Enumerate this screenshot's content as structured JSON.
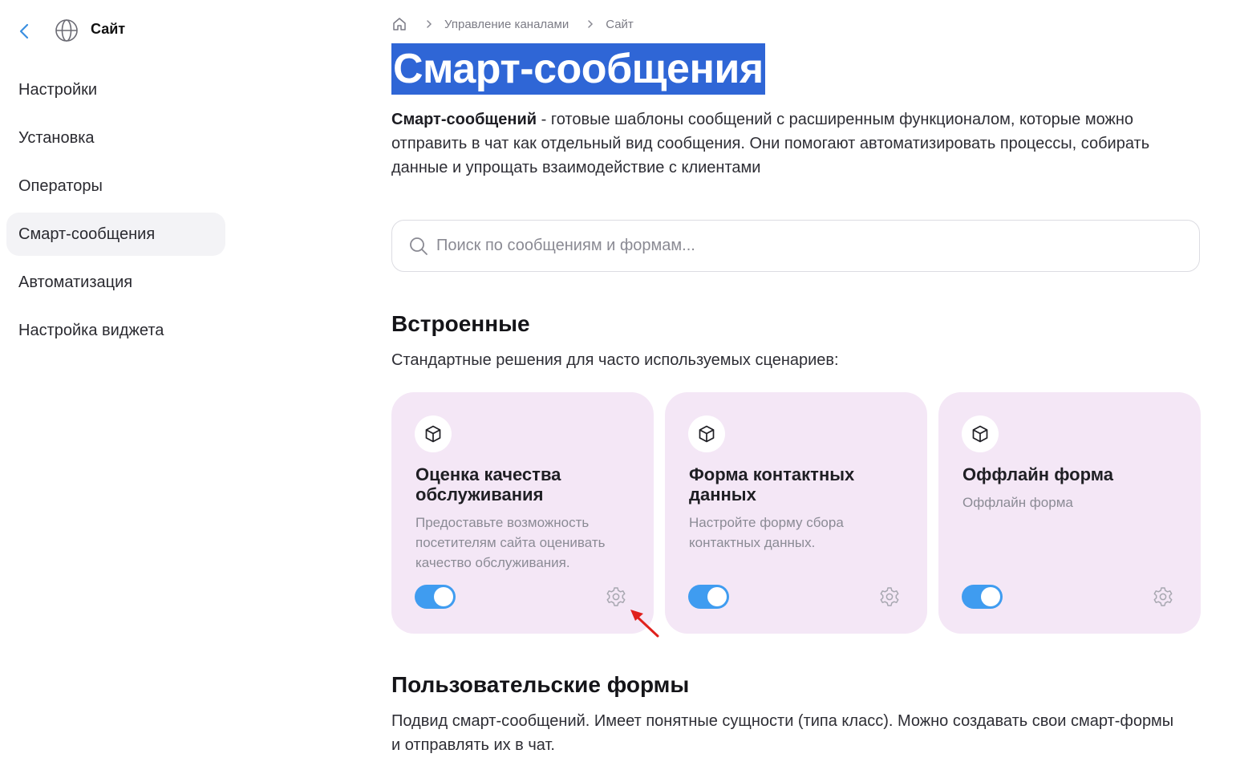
{
  "sidebar": {
    "title": "Сайт",
    "items": [
      {
        "label": "Настройки"
      },
      {
        "label": "Установка"
      },
      {
        "label": "Операторы"
      },
      {
        "label": "Смарт-сообщения",
        "active": true
      },
      {
        "label": "Автоматизация"
      },
      {
        "label": "Настройка виджета"
      }
    ]
  },
  "breadcrumb": {
    "items": [
      "Управление каналами",
      "Сайт"
    ]
  },
  "page": {
    "title": "Смарт-сообщения",
    "intro_bold": "Смарт-сообщений",
    "intro_rest": " - готовые шаблоны сообщений с расширенным функционалом, которые можно отправить в чат как отдельный вид сообщения. Они помогают автоматизировать процессы, собирать данные и упрощать взаимодействие с клиентами"
  },
  "search": {
    "placeholder": "Поиск по сообщениям и формам...",
    "value": ""
  },
  "builtin": {
    "heading": "Встроенные",
    "subtitle": "Стандартные решения для часто используемых сценариев:",
    "cards": [
      {
        "title": "Оценка качества обслуживания",
        "description": "Предоставьте возможность посетителям сайта оценивать качество обслуживания.",
        "enabled": true
      },
      {
        "title": "Форма контактных данных",
        "description": "Настройте форму сбора контактных данных.",
        "enabled": true
      },
      {
        "title": "Оффлайн форма",
        "description": "Оффлайн форма",
        "enabled": true
      }
    ]
  },
  "custom": {
    "heading": "Пользовательские формы",
    "subtitle": "Подвид смарт-сообщений. Имеет понятные сущности (типа класс). Можно создавать свои смарт-формы и отправлять их в чат."
  },
  "colors": {
    "accent": "#3f9cf0",
    "card_bg": "#f4e7f6",
    "title_highlight": "#2f66d6",
    "annotation_arrow": "#e0201c"
  },
  "icons": {
    "back": "chevron-left-icon",
    "site": "globe-icon",
    "home": "home-icon",
    "separator": "chevron-right-icon",
    "search": "search-icon",
    "card": "cube-icon",
    "settings": "gear-icon"
  }
}
